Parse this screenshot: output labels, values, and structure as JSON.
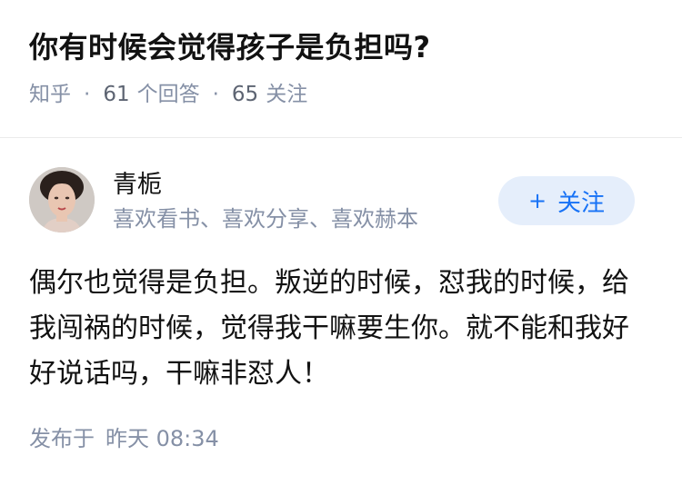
{
  "question": {
    "title": "你有时候会觉得孩子是负担吗?",
    "source": "知乎",
    "answer_count": "61",
    "answer_label": "个回答",
    "follow_count": "65",
    "follow_label": "关注"
  },
  "author": {
    "name": "青栀",
    "bio": "喜欢看书、喜欢分享、喜欢赫本",
    "avatar_icon": "portrait-avatar-icon"
  },
  "follow_button": {
    "plus": "+",
    "label": "关注"
  },
  "answer": {
    "content": "偶尔也觉得是负担。叛逆的时候，怼我的时候，给我闯祸的时候，觉得我干嘛要生你。就不能和我好好说话吗，干嘛非怼人！"
  },
  "publish": {
    "label": "发布于",
    "time": "昨天 08:34"
  },
  "colors": {
    "meta_gray": "#8590a6",
    "accent_blue": "#1772f6",
    "button_bg": "#e5eefb"
  }
}
